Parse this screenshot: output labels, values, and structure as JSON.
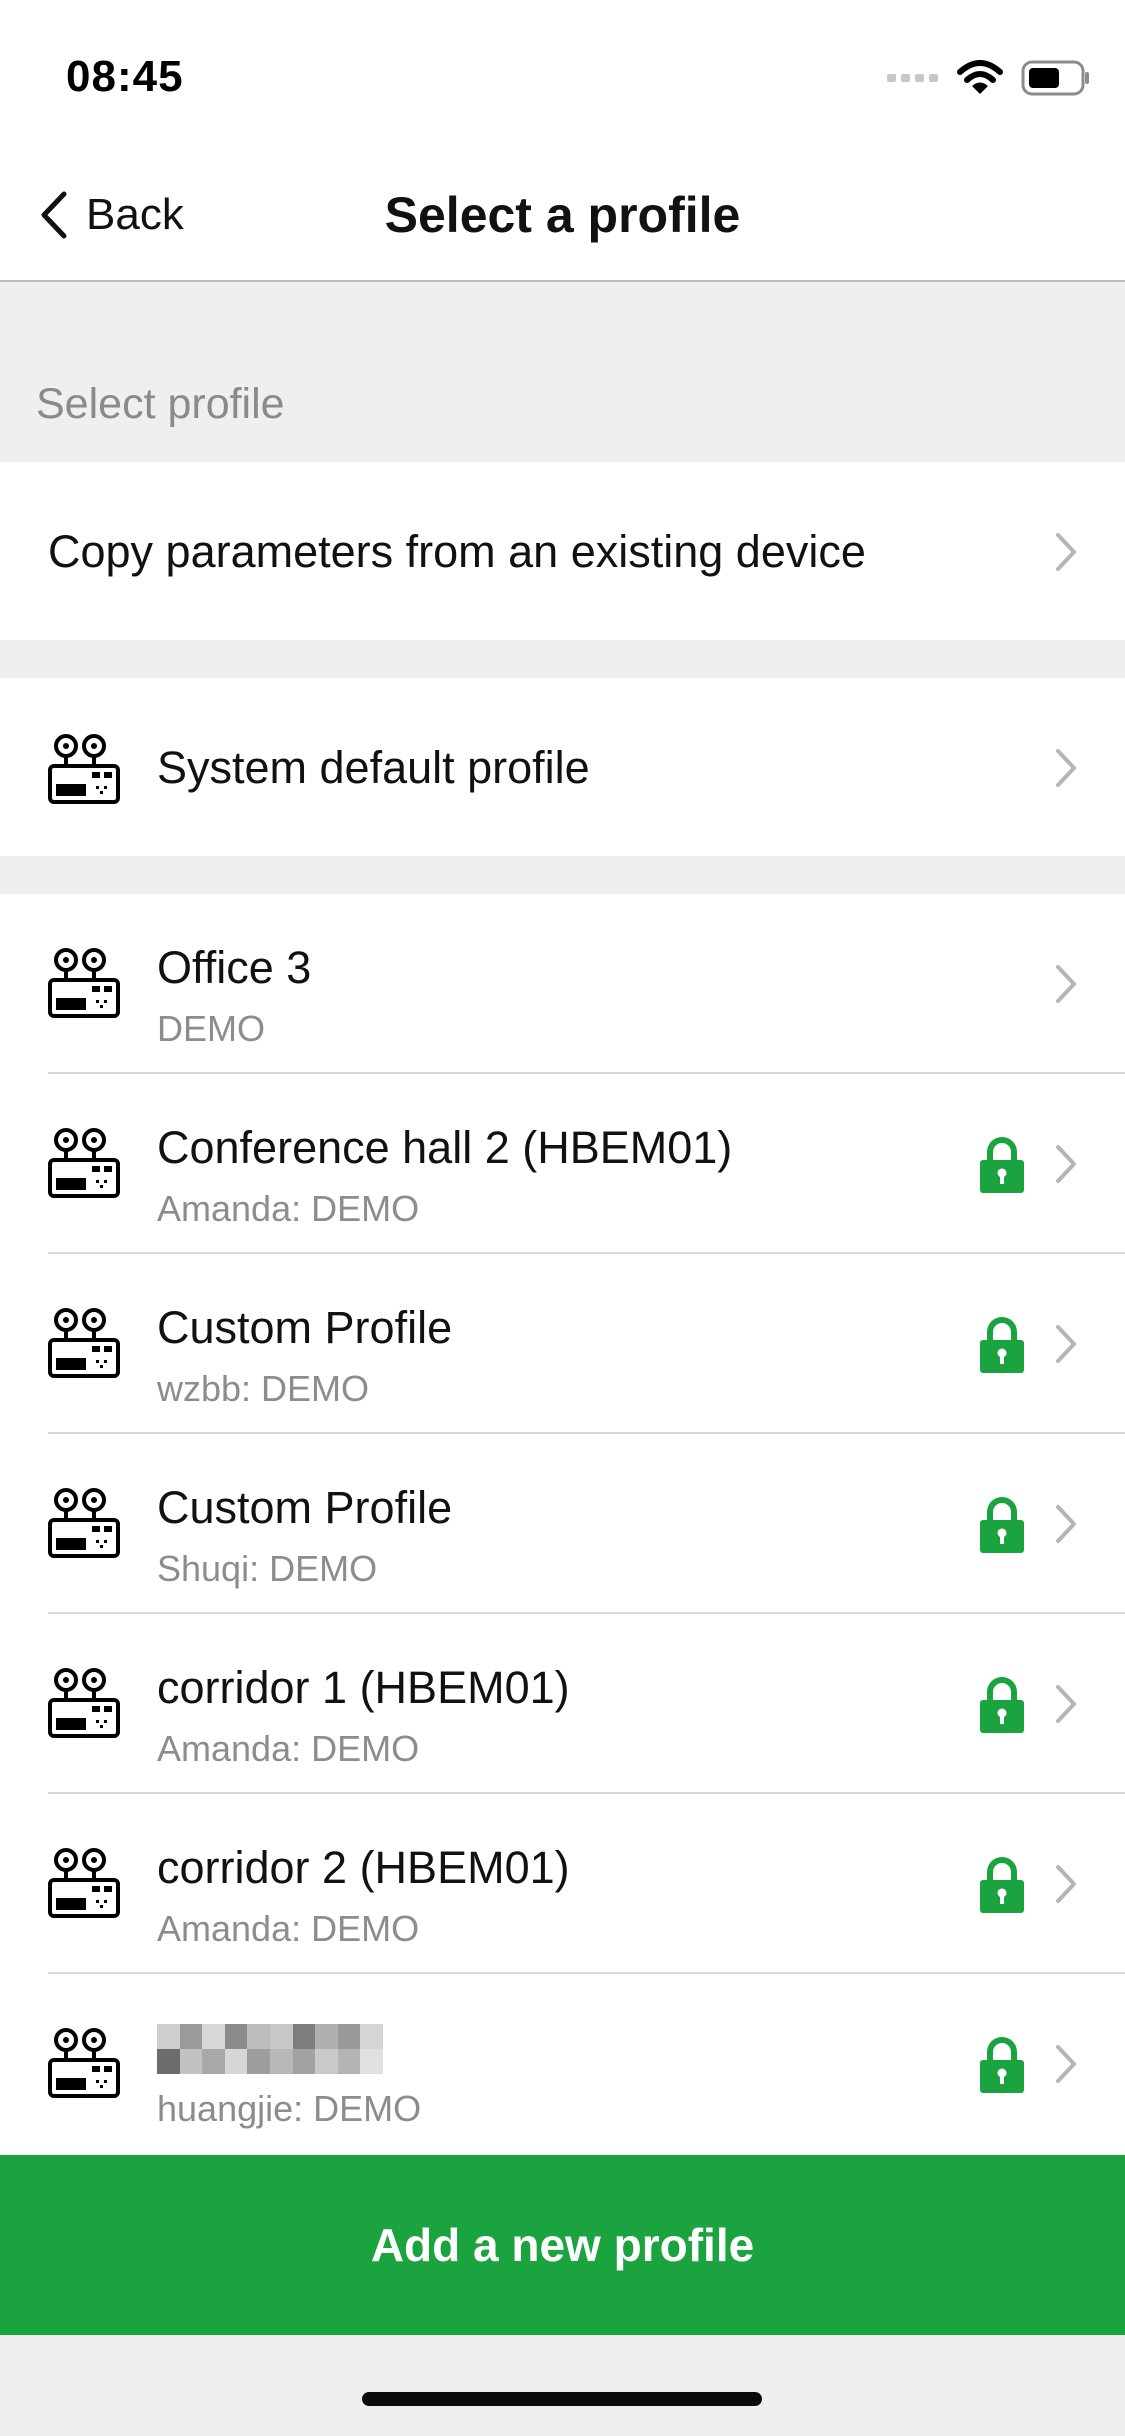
{
  "status_bar": {
    "time": "08:45"
  },
  "nav": {
    "back_label": "Back",
    "title": "Select a profile"
  },
  "section_header": "Select profile",
  "copy_row": {
    "label": "Copy parameters from an existing device"
  },
  "default_row": {
    "label": "System default profile"
  },
  "profiles": [
    {
      "title": "Office 3",
      "subtitle": "DEMO",
      "locked": false
    },
    {
      "title": "Conference hall 2 (HBEM01)",
      "subtitle": "Amanda: DEMO",
      "locked": true
    },
    {
      "title": "Custom Profile",
      "subtitle": "wzbb: DEMO",
      "locked": true
    },
    {
      "title": "Custom Profile",
      "subtitle": "Shuqi: DEMO",
      "locked": true
    },
    {
      "title": "corridor 1 (HBEM01)",
      "subtitle": "Amanda: DEMO",
      "locked": true
    },
    {
      "title": "corridor 2 (HBEM01)",
      "subtitle": "Amanda: DEMO",
      "locked": true
    },
    {
      "title": "",
      "subtitle": "huangjie: DEMO",
      "locked": true
    }
  ],
  "add_button_label": "Add a new profile",
  "icons": {
    "back": "chevron-left-icon",
    "row": "device-icon",
    "lock": "lock-icon",
    "chevron": "chevron-right-icon"
  },
  "colors": {
    "accent": "#1aa33f",
    "lock": "#1aa33f",
    "background": "#efefef",
    "secondary_text": "#8c8c8c"
  }
}
